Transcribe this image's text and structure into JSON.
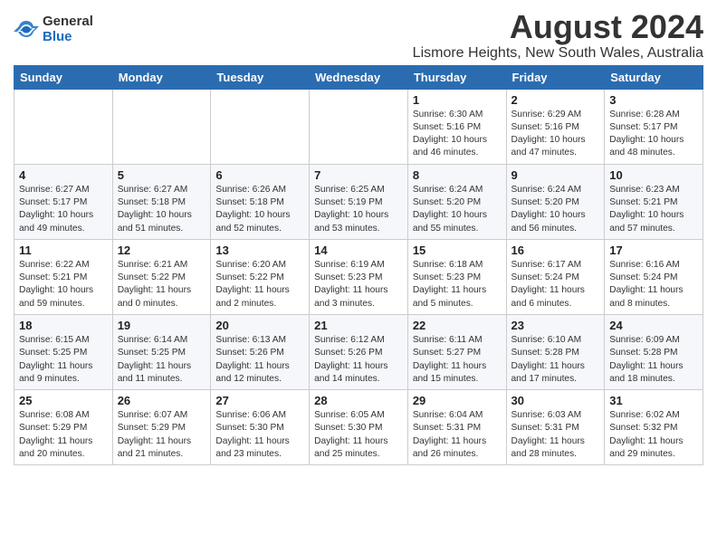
{
  "header": {
    "logo_general": "General",
    "logo_blue": "Blue",
    "month_title": "August 2024",
    "location": "Lismore Heights, New South Wales, Australia"
  },
  "days_of_week": [
    "Sunday",
    "Monday",
    "Tuesday",
    "Wednesday",
    "Thursday",
    "Friday",
    "Saturday"
  ],
  "weeks": [
    [
      {
        "day": "",
        "info": ""
      },
      {
        "day": "",
        "info": ""
      },
      {
        "day": "",
        "info": ""
      },
      {
        "day": "",
        "info": ""
      },
      {
        "day": "1",
        "info": "Sunrise: 6:30 AM\nSunset: 5:16 PM\nDaylight: 10 hours\nand 46 minutes."
      },
      {
        "day": "2",
        "info": "Sunrise: 6:29 AM\nSunset: 5:16 PM\nDaylight: 10 hours\nand 47 minutes."
      },
      {
        "day": "3",
        "info": "Sunrise: 6:28 AM\nSunset: 5:17 PM\nDaylight: 10 hours\nand 48 minutes."
      }
    ],
    [
      {
        "day": "4",
        "info": "Sunrise: 6:27 AM\nSunset: 5:17 PM\nDaylight: 10 hours\nand 49 minutes."
      },
      {
        "day": "5",
        "info": "Sunrise: 6:27 AM\nSunset: 5:18 PM\nDaylight: 10 hours\nand 51 minutes."
      },
      {
        "day": "6",
        "info": "Sunrise: 6:26 AM\nSunset: 5:18 PM\nDaylight: 10 hours\nand 52 minutes."
      },
      {
        "day": "7",
        "info": "Sunrise: 6:25 AM\nSunset: 5:19 PM\nDaylight: 10 hours\nand 53 minutes."
      },
      {
        "day": "8",
        "info": "Sunrise: 6:24 AM\nSunset: 5:20 PM\nDaylight: 10 hours\nand 55 minutes."
      },
      {
        "day": "9",
        "info": "Sunrise: 6:24 AM\nSunset: 5:20 PM\nDaylight: 10 hours\nand 56 minutes."
      },
      {
        "day": "10",
        "info": "Sunrise: 6:23 AM\nSunset: 5:21 PM\nDaylight: 10 hours\nand 57 minutes."
      }
    ],
    [
      {
        "day": "11",
        "info": "Sunrise: 6:22 AM\nSunset: 5:21 PM\nDaylight: 10 hours\nand 59 minutes."
      },
      {
        "day": "12",
        "info": "Sunrise: 6:21 AM\nSunset: 5:22 PM\nDaylight: 11 hours\nand 0 minutes."
      },
      {
        "day": "13",
        "info": "Sunrise: 6:20 AM\nSunset: 5:22 PM\nDaylight: 11 hours\nand 2 minutes."
      },
      {
        "day": "14",
        "info": "Sunrise: 6:19 AM\nSunset: 5:23 PM\nDaylight: 11 hours\nand 3 minutes."
      },
      {
        "day": "15",
        "info": "Sunrise: 6:18 AM\nSunset: 5:23 PM\nDaylight: 11 hours\nand 5 minutes."
      },
      {
        "day": "16",
        "info": "Sunrise: 6:17 AM\nSunset: 5:24 PM\nDaylight: 11 hours\nand 6 minutes."
      },
      {
        "day": "17",
        "info": "Sunrise: 6:16 AM\nSunset: 5:24 PM\nDaylight: 11 hours\nand 8 minutes."
      }
    ],
    [
      {
        "day": "18",
        "info": "Sunrise: 6:15 AM\nSunset: 5:25 PM\nDaylight: 11 hours\nand 9 minutes."
      },
      {
        "day": "19",
        "info": "Sunrise: 6:14 AM\nSunset: 5:25 PM\nDaylight: 11 hours\nand 11 minutes."
      },
      {
        "day": "20",
        "info": "Sunrise: 6:13 AM\nSunset: 5:26 PM\nDaylight: 11 hours\nand 12 minutes."
      },
      {
        "day": "21",
        "info": "Sunrise: 6:12 AM\nSunset: 5:26 PM\nDaylight: 11 hours\nand 14 minutes."
      },
      {
        "day": "22",
        "info": "Sunrise: 6:11 AM\nSunset: 5:27 PM\nDaylight: 11 hours\nand 15 minutes."
      },
      {
        "day": "23",
        "info": "Sunrise: 6:10 AM\nSunset: 5:28 PM\nDaylight: 11 hours\nand 17 minutes."
      },
      {
        "day": "24",
        "info": "Sunrise: 6:09 AM\nSunset: 5:28 PM\nDaylight: 11 hours\nand 18 minutes."
      }
    ],
    [
      {
        "day": "25",
        "info": "Sunrise: 6:08 AM\nSunset: 5:29 PM\nDaylight: 11 hours\nand 20 minutes."
      },
      {
        "day": "26",
        "info": "Sunrise: 6:07 AM\nSunset: 5:29 PM\nDaylight: 11 hours\nand 21 minutes."
      },
      {
        "day": "27",
        "info": "Sunrise: 6:06 AM\nSunset: 5:30 PM\nDaylight: 11 hours\nand 23 minutes."
      },
      {
        "day": "28",
        "info": "Sunrise: 6:05 AM\nSunset: 5:30 PM\nDaylight: 11 hours\nand 25 minutes."
      },
      {
        "day": "29",
        "info": "Sunrise: 6:04 AM\nSunset: 5:31 PM\nDaylight: 11 hours\nand 26 minutes."
      },
      {
        "day": "30",
        "info": "Sunrise: 6:03 AM\nSunset: 5:31 PM\nDaylight: 11 hours\nand 28 minutes."
      },
      {
        "day": "31",
        "info": "Sunrise: 6:02 AM\nSunset: 5:32 PM\nDaylight: 11 hours\nand 29 minutes."
      }
    ]
  ]
}
